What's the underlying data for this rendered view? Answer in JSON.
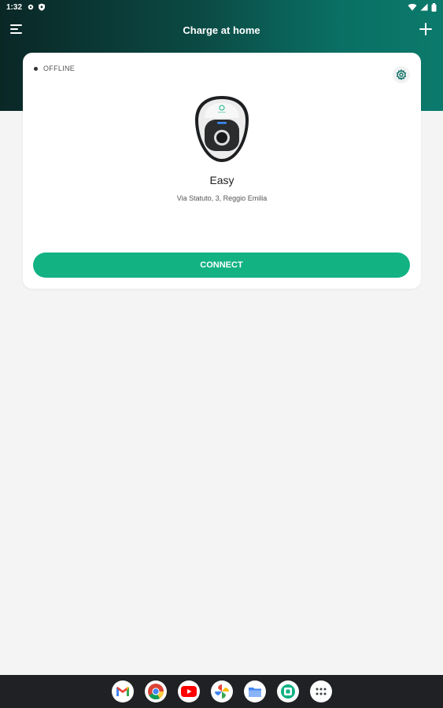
{
  "status_bar": {
    "time": "1:32",
    "left_icons": [
      "settings-icon",
      "shield-icon"
    ],
    "right_icons": [
      "wifi-icon",
      "signal-icon",
      "battery-icon"
    ]
  },
  "app_bar": {
    "title": "Charge at home",
    "menu_icon": "menu-icon",
    "add_icon": "plus-icon"
  },
  "charger_card": {
    "status": "OFFLINE",
    "name": "Easy",
    "address": "Via Statuto, 3, Reggio Emilia",
    "connect_label": "CONNECT"
  },
  "dock": {
    "apps": [
      "gmail-icon",
      "chrome-icon",
      "youtube-icon",
      "photos-icon",
      "files-icon",
      "app-icon",
      "app-drawer-icon"
    ]
  },
  "colors": {
    "accent": "#12b283",
    "header_dark": "#0a2726",
    "header_teal": "#0b7a6c",
    "background": "#f4f4f4"
  }
}
